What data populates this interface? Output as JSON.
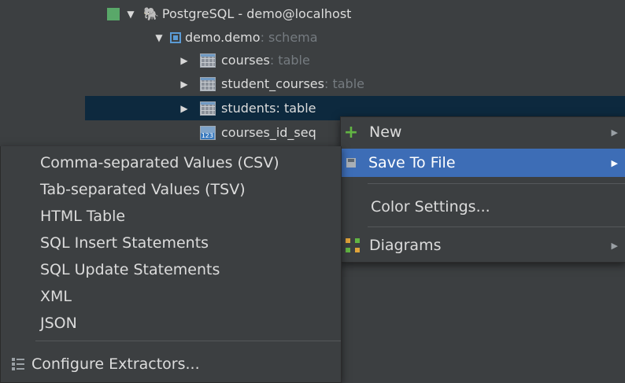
{
  "tree": {
    "root_label": "PostgreSQL - demo@localhost",
    "schema_name": "demo.demo",
    "schema_type": ": schema",
    "items": [
      {
        "name": "courses",
        "type": ": table"
      },
      {
        "name": "student_courses",
        "type": ": table"
      },
      {
        "name": "students",
        "type": ": table"
      },
      {
        "name": "courses_id_seq",
        "type": ""
      }
    ],
    "seq_badge": "123"
  },
  "context_menu": {
    "items": [
      {
        "label": "New",
        "has_submenu": true
      },
      {
        "label": "Save To File",
        "has_submenu": true,
        "active": true
      },
      {
        "label": "Color Settings...",
        "has_submenu": false
      },
      {
        "label": "Diagrams",
        "has_submenu": true
      }
    ]
  },
  "submenu": {
    "items": [
      "Comma-separated Values (CSV)",
      "Tab-separated Values (TSV)",
      "HTML Table",
      "SQL Insert Statements",
      "SQL Update Statements",
      "XML",
      "JSON"
    ],
    "configure_label": "Configure Extractors..."
  },
  "colors": {
    "background": "#3c3f41",
    "selection": "#0d293e",
    "menu_highlight": "#3d6db6",
    "green_accent": "#62b543"
  },
  "icons": {
    "root": "elephant-icon",
    "schema": "schema-icon",
    "table": "table-icon",
    "sequence": "sequence-icon",
    "new": "plus-icon",
    "save": "save-icon",
    "diagrams": "diagram-icon",
    "configure": "extractor-list-icon"
  }
}
